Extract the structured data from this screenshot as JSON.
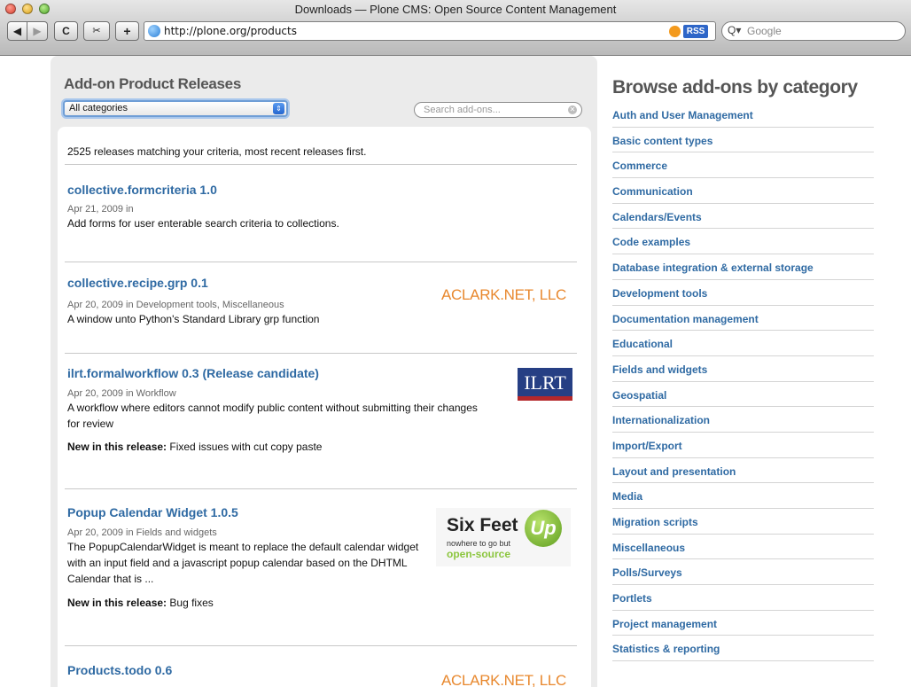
{
  "window": {
    "title": "Downloads — Plone CMS: Open Source Content Management",
    "url": "http://plone.org/products",
    "rss_label": "RSS",
    "search_placeholder": "Google"
  },
  "toolbar": {
    "back_glyph": "◀",
    "forward_glyph": "▶",
    "reload_glyph": "C",
    "snippet_glyph": "✂",
    "add_glyph": "+"
  },
  "icons": {
    "traffic_lights": [
      "close-icon",
      "minimize-icon",
      "zoom-icon"
    ],
    "url": "globe-icon",
    "rss": "rss-icon",
    "web_search": "magnifier-icon",
    "select_arrow": "updown-arrow-icon",
    "search_clear": "clear-icon"
  },
  "colors": {
    "link": "#2f6aa3",
    "panel_bg": "#ebebeb",
    "heading": "#555555",
    "aclark_orange": "#e8882e",
    "ilrt_blue": "#263f84",
    "ilrt_red": "#b4282b",
    "sixfeet_green": "#8cc63f"
  },
  "main": {
    "heading": "Add-on Product Releases",
    "category_select": {
      "selected": "All categories"
    },
    "search": {
      "placeholder": "Search add-ons..."
    },
    "results_count": "2525 releases matching your criteria, most recent releases first.",
    "new_in_release_label": "New in this release:",
    "releases": [
      {
        "title": "collective.formcriteria 1.0",
        "date": "Apr 21, 2009 in",
        "description": "Add forms for user enterable search criteria to collections.",
        "new_in_release": ""
      },
      {
        "title": "collective.recipe.grp 0.1",
        "date": "Apr 20, 2009 in Development tools, Miscellaneous",
        "description": "A window unto Python's Standard Library grp function",
        "new_in_release": "",
        "logo_text": "ACLARK.NET, LLC"
      },
      {
        "title": "ilrt.formalworkflow 0.3 (Release candidate)",
        "date": "Apr 20, 2009 in Workflow",
        "description": "A workflow where editors cannot modify public content without submitting their changes for review",
        "new_in_release": "Fixed issues with cut copy paste",
        "logo_text": "ILRT"
      },
      {
        "title": "Popup Calendar Widget 1.0.5",
        "date": "Apr 20, 2009 in Fields and widgets",
        "description": "The PopupCalendarWidget is meant to replace the default calendar widget with an input field and a javascript popup calendar based on the DHTML Calendar that is ...",
        "new_in_release": "Bug fixes",
        "logo_text": "Six Feet",
        "logo_glyph": "Up",
        "logo_sub": "nowhere to go but",
        "logo_os": "open-source"
      },
      {
        "title": "Products.todo 0.6",
        "logo_text": "ACLARK.NET, LLC"
      }
    ]
  },
  "sidebar": {
    "heading": "Browse add-ons by category",
    "categories": [
      "Auth and User Management",
      "Basic content types",
      "Commerce",
      "Communication",
      "Calendars/Events",
      "Code examples",
      "Database integration & external storage",
      "Development tools",
      "Documentation management",
      "Educational",
      "Fields and widgets",
      "Geospatial",
      "Internationalization",
      "Import/Export",
      "Layout and presentation",
      "Media",
      "Migration scripts",
      "Miscellaneous",
      "Polls/Surveys",
      "Portlets",
      "Project management",
      "Statistics & reporting"
    ]
  }
}
